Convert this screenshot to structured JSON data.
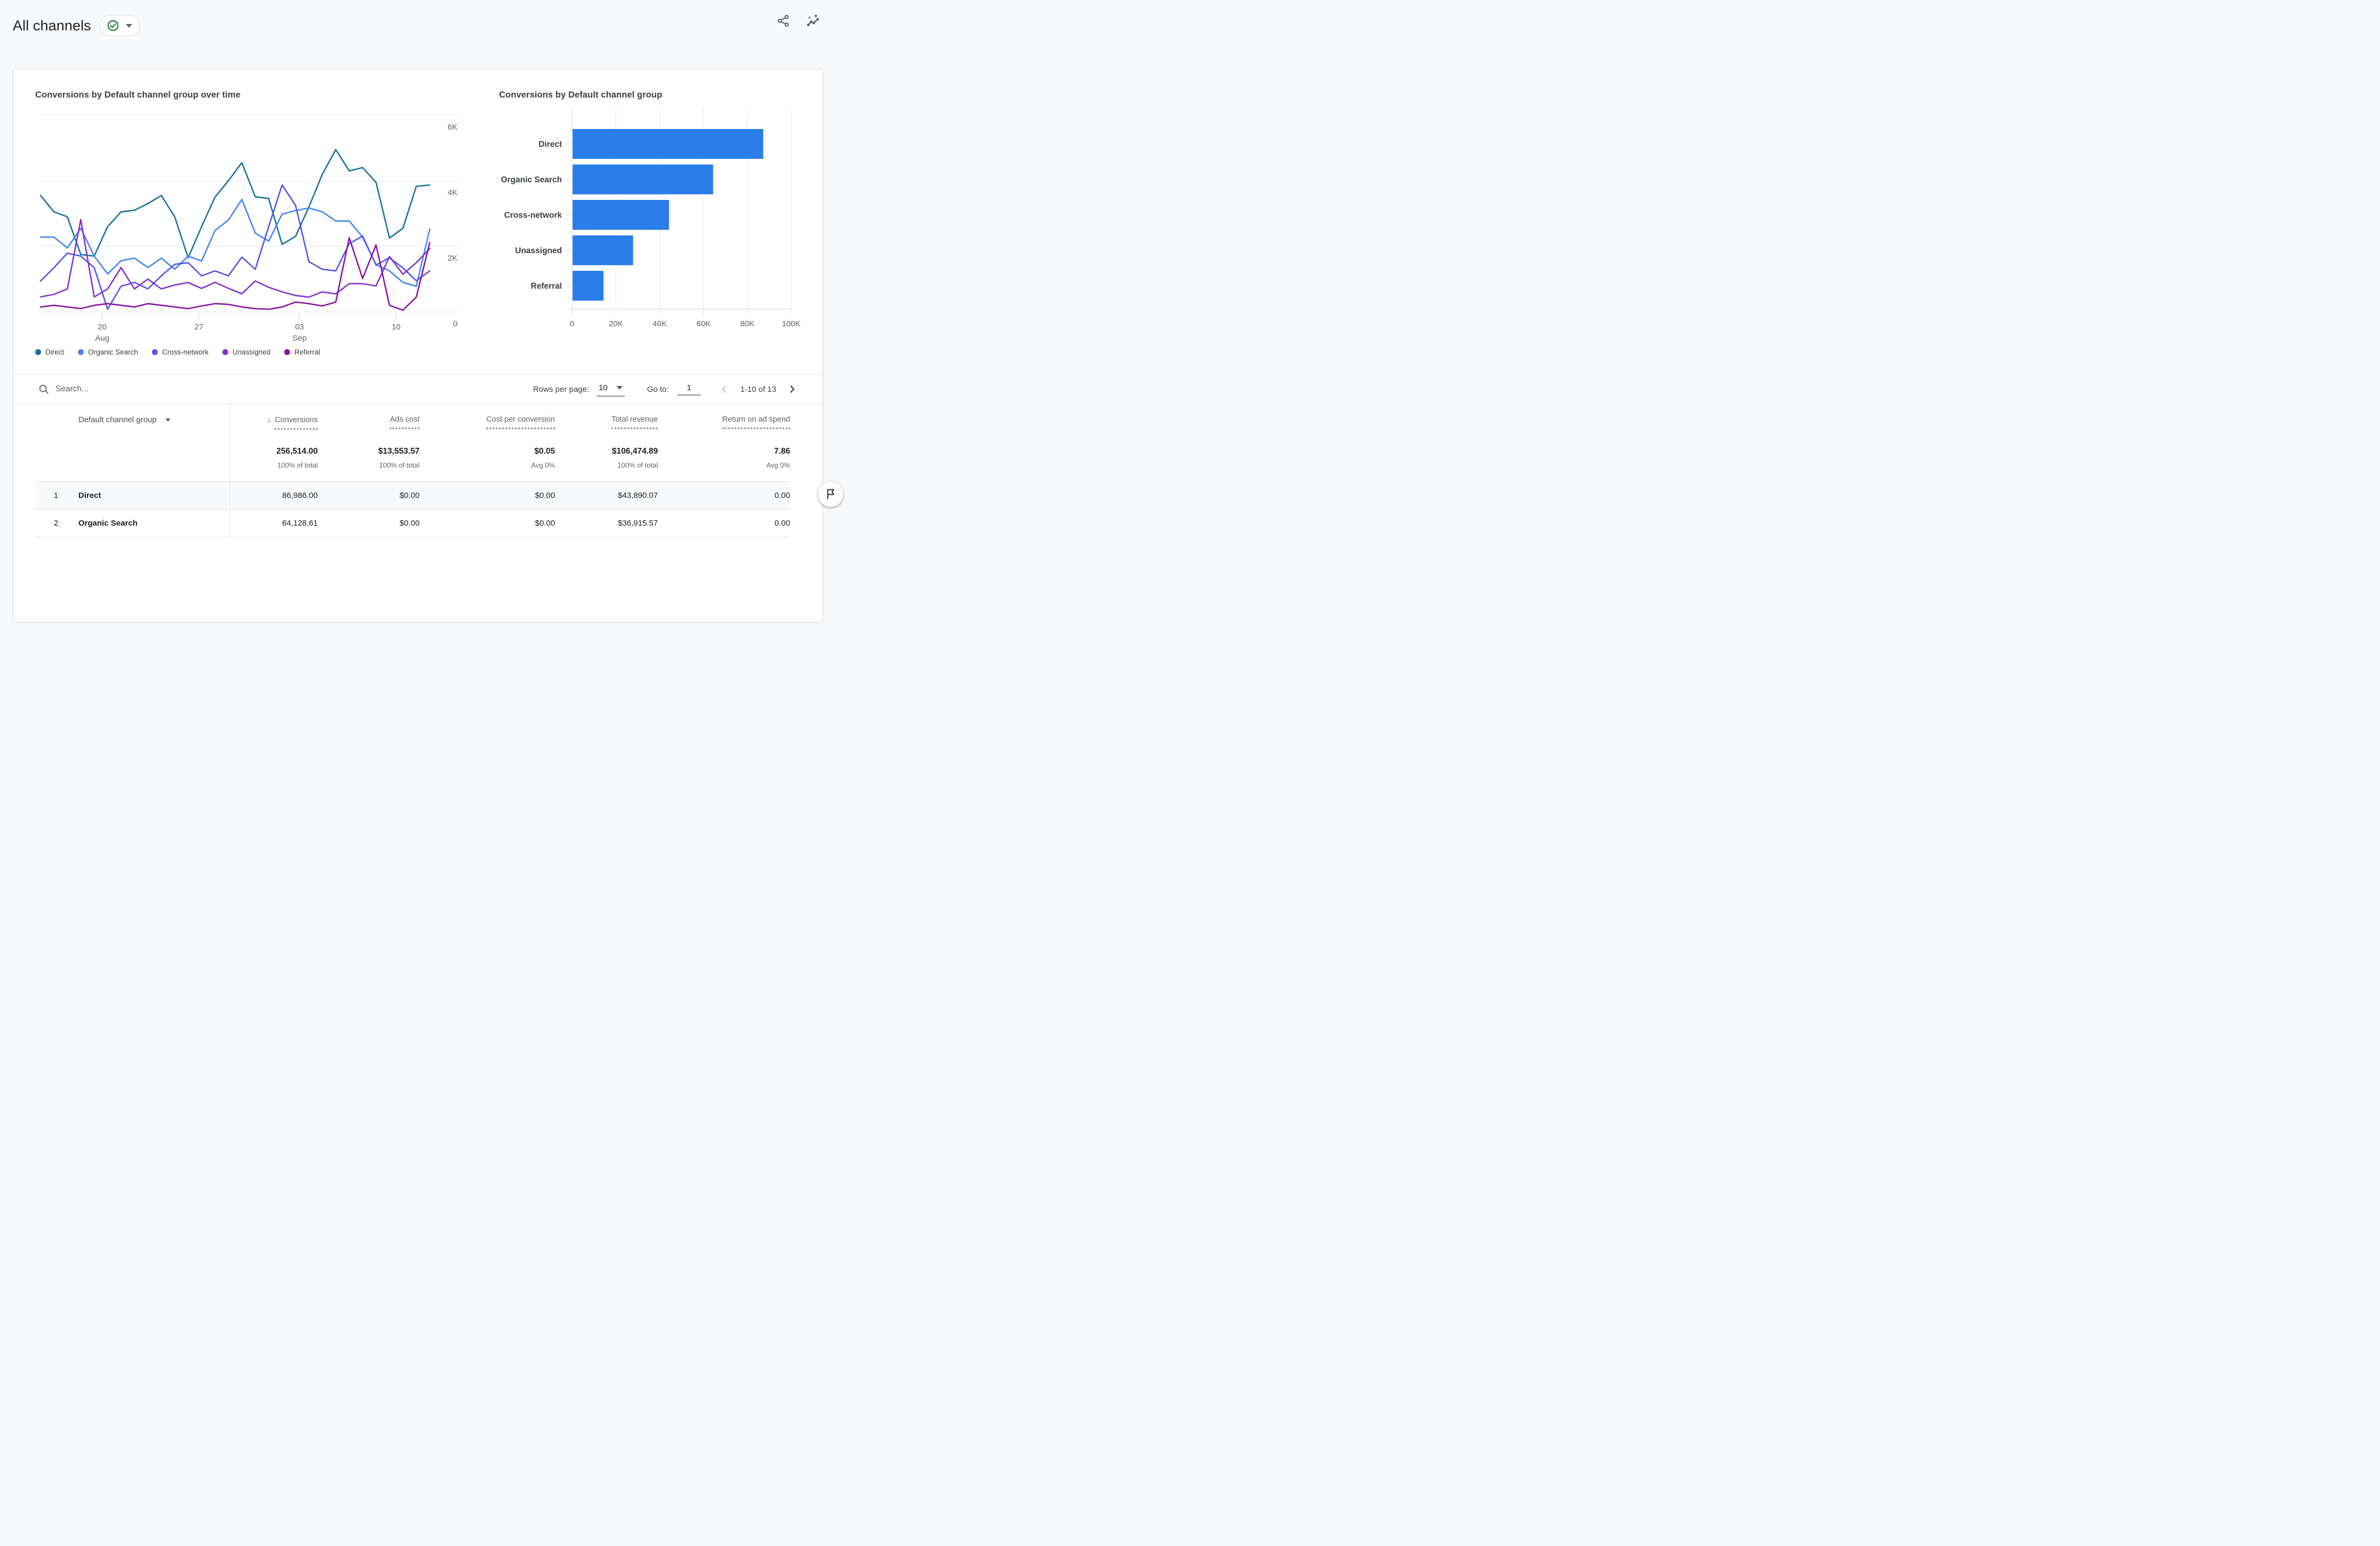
{
  "app": {
    "title": "All channels"
  },
  "colors": {
    "bar": "#2b7de9",
    "check_green": "#1e8e3e",
    "grid": "#e8eaed",
    "axis": "#dadce0",
    "text_secondary": "#5f6368",
    "bar_label": "#3c4043"
  },
  "icons": {
    "sort_desc": "↓"
  },
  "chart_data": [
    {
      "type": "line",
      "title": "Conversions by Default channel group over time",
      "ylim": [
        0,
        6000
      ],
      "grid": "horizontal",
      "legend_position": "bottom",
      "y_ticks": [
        {
          "label": "6K",
          "value": 6000
        },
        {
          "label": "4K",
          "value": 4000
        },
        {
          "label": "2K",
          "value": 2000
        },
        {
          "label": "0",
          "value": 0
        }
      ],
      "x_ticks": [
        {
          "label": "20",
          "sub": "Aug",
          "index": 4.6
        },
        {
          "label": "27",
          "sub": "",
          "index": 11.8
        },
        {
          "label": "03",
          "sub": "Sep",
          "index": 19.3
        },
        {
          "label": "10",
          "sub": "",
          "index": 26.5
        }
      ],
      "series": [
        {
          "name": "Direct",
          "color": "#15739c",
          "values": [
            3550,
            3050,
            2900,
            1750,
            1700,
            2600,
            3050,
            3100,
            3300,
            3550,
            2900,
            1650,
            2600,
            3500,
            4000,
            4550,
            3510,
            3460,
            2060,
            2300,
            3200,
            4200,
            4950,
            4300,
            4400,
            3950,
            2250,
            2550,
            3830,
            3870
          ]
        },
        {
          "name": "Organic Search",
          "color": "#4285f4",
          "values": [
            2280,
            2280,
            1950,
            2550,
            1700,
            1160,
            1560,
            1640,
            1350,
            1640,
            1300,
            1700,
            1550,
            2480,
            2800,
            3430,
            2400,
            2160,
            2980,
            3090,
            3170,
            3050,
            2770,
            2770,
            2280,
            1440,
            1250,
            900,
            780,
            2520
          ]
        },
        {
          "name": "Cross-network",
          "color": "#5156e5",
          "values": [
            940,
            1350,
            1790,
            1700,
            1350,
            80,
            780,
            900,
            700,
            1100,
            1450,
            1500,
            1100,
            1250,
            1100,
            1670,
            1300,
            2600,
            3870,
            3250,
            1530,
            1300,
            1250,
            2080,
            2310,
            1430,
            1650,
            1340,
            950,
            1250
          ]
        },
        {
          "name": "Unassigned",
          "color": "#8430ce",
          "values": [
            455,
            535,
            700,
            2815,
            455,
            700,
            1350,
            700,
            1000,
            700,
            820,
            894,
            715,
            900,
            715,
            553,
            943,
            750,
            610,
            500,
            450,
            610,
            550,
            860,
            860,
            790,
            1690,
            1150,
            1500,
            1930
          ]
        },
        {
          "name": "Referral",
          "color": "#8713a2",
          "values": [
            150,
            200,
            150,
            100,
            200,
            250,
            200,
            150,
            250,
            200,
            150,
            100,
            180,
            250,
            230,
            150,
            100,
            80,
            150,
            300,
            250,
            180,
            300,
            2260,
            1020,
            2040,
            200,
            50,
            450,
            2110
          ]
        }
      ]
    },
    {
      "type": "bar",
      "title": "Conversions by Default channel group",
      "orientation": "horizontal",
      "xlim": [
        0,
        100000
      ],
      "x_ticks": [
        "0",
        "20K",
        "40K",
        "60K",
        "80K",
        "100K"
      ],
      "categories": [
        "Direct",
        "Organic Search",
        "Cross-network",
        "Unassigned",
        "Referral"
      ],
      "values": [
        86986,
        64129,
        44000,
        27600,
        14100
      ]
    }
  ],
  "toolbar": {
    "search_placeholder": "Search...",
    "rows_per_page_label": "Rows per page:",
    "rows_per_page_value": "10",
    "go_to_label": "Go to:",
    "go_to_value": "1",
    "range": "1-10 of 13"
  },
  "table": {
    "dimension_header": "Default channel group",
    "metric_headers": [
      "Conversions",
      "Ads cost",
      "Cost per conversion",
      "Total revenue",
      "Return on ad spend"
    ],
    "totals": {
      "values": [
        "256,514.00",
        "$13,553.57",
        "$0.05",
        "$106,474.89",
        "7.86"
      ],
      "subs": [
        "100% of total",
        "100% of total",
        "Avg 0%",
        "100% of total",
        "Avg 0%"
      ]
    },
    "rows": [
      {
        "num": "1",
        "channel": "Direct",
        "values": [
          "86,986.00",
          "$0.00",
          "$0.00",
          "$43,890.07",
          "0.00"
        ]
      },
      {
        "num": "2",
        "channel": "Organic Search",
        "values": [
          "64,128.61",
          "$0.00",
          "$0.00",
          "$36,915.57",
          "0.00"
        ]
      }
    ]
  }
}
